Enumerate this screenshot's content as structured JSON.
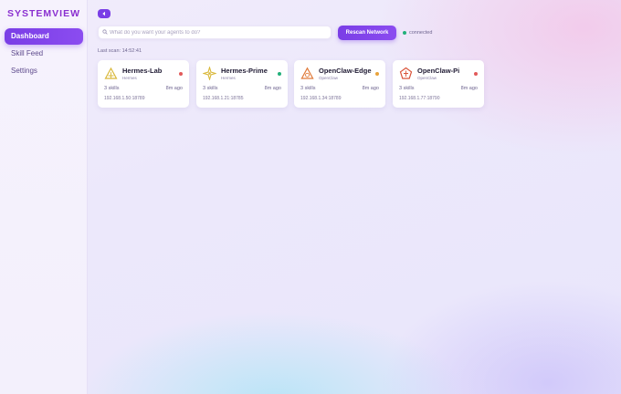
{
  "app": {
    "brand": "SYSTEMVIEW"
  },
  "sidebar": {
    "items": [
      {
        "label": "Dashboard",
        "active": true
      },
      {
        "label": "Skill Feed",
        "active": false
      },
      {
        "label": "Settings",
        "active": false
      }
    ]
  },
  "toolbar": {
    "search_placeholder": "What do you want your agents to do?",
    "search_value": "",
    "rescan_label": "Rescan Network",
    "status_label": "connected",
    "status_color": "#22b07a",
    "accent_color": "#7a3ee6"
  },
  "last_scan": "Last scan: 14:52:41",
  "agents": [
    {
      "name": "Hermes-Lab",
      "kind": "Hermes",
      "skills": "3 skills",
      "ago": "8m ago",
      "address": "192.168.1.50:18789",
      "status_color": "#e25a5a",
      "icon": "hermes-triangle-icon",
      "icon_color": "#d9b83a"
    },
    {
      "name": "Hermes-Prime",
      "kind": "Hermes",
      "skills": "3 skills",
      "ago": "8m ago",
      "address": "192.168.1.21:18785",
      "status_color": "#22b07a",
      "icon": "hermes-star-icon",
      "icon_color": "#d9b83a"
    },
    {
      "name": "OpenClaw-Edge",
      "kind": "OpenClaw",
      "skills": "3 skills",
      "ago": "8m ago",
      "address": "192.168.1.34:18789",
      "status_color": "#e8a23a",
      "icon": "openclaw-triangle-icon",
      "icon_color": "#e07a3a"
    },
    {
      "name": "OpenClaw-Pi",
      "kind": "OpenClaw",
      "skills": "3 skills",
      "ago": "8m ago",
      "address": "192.168.1.77:18790",
      "status_color": "#e25a5a",
      "icon": "openclaw-pentagon-icon",
      "icon_color": "#d9533a"
    }
  ]
}
